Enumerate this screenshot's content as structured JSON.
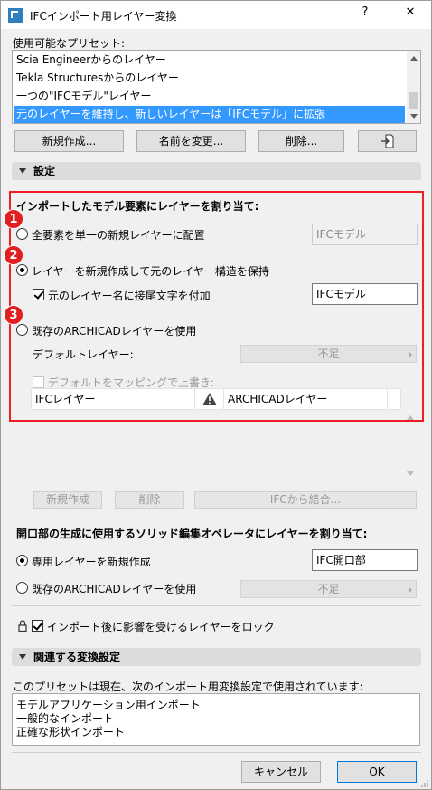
{
  "window": {
    "title": "IFCインポート用レイヤー変換",
    "help_label": "?",
    "close_label": "✕"
  },
  "presets": {
    "label": "使用可能なプリセット:",
    "items": [
      "Scia Engineerからのレイヤー",
      "Tekla Structuresからのレイヤー",
      "一つの\"IFCモデル\"レイヤー",
      "元のレイヤーを維持し、新しいレイヤーは「IFCモデル」に拡張"
    ],
    "selected_index": 3,
    "buttons": {
      "new": "新規作成...",
      "rename": "名前を変更...",
      "delete": "削除...",
      "import_icon": "import-file-icon"
    }
  },
  "settings": {
    "header": "設定",
    "assign_title": "インポートしたモデル要素にレイヤーを割り当て:",
    "option1_label": "全要素を単一の新規レイヤーに配置",
    "option1_value": "IFCモデル",
    "option2_label": "レイヤーを新規作成して元のレイヤー構造を保持",
    "option2_suffix_label": "元のレイヤー名に接尾文字を付加",
    "option2_suffix_value": "IFCモデル",
    "option3_label": "既存のARCHICADレイヤーを使用",
    "default_layer_label": "デフォルトレイヤー:",
    "default_layer_value": "不足",
    "override_label": "デフォルトをマッピングで上書き:",
    "table": {
      "col1": "IFCレイヤー",
      "col2": "ARCHICADレイヤー",
      "warning_icon": "warning-icon"
    },
    "badges": [
      "1",
      "2",
      "3"
    ],
    "table_buttons": {
      "new": "新規作成",
      "delete": "削除",
      "merge": "IFCから結合..."
    }
  },
  "openings": {
    "title": "開口部の生成に使用するソリッド編集オペレータにレイヤーを割り当て:",
    "option1_label": "専用レイヤーを新規作成",
    "option1_value": "IFC開口部",
    "option2_label": "既存のARCHICADレイヤーを使用",
    "option2_value": "不足"
  },
  "lock": {
    "label": "インポート後に影響を受けるレイヤーをロック",
    "icon": "lock-icon"
  },
  "related": {
    "header": "関連する変換設定",
    "description": "このプリセットは現在、次のインポート用変換設定で使用されています:",
    "items": [
      "モデルアプリケーション用インポート",
      "一般的なインポート",
      "正確な形状インポート"
    ]
  },
  "footer": {
    "cancel": "キャンセル",
    "ok": "OK"
  },
  "colors": {
    "selection": "#3399ff",
    "highlight_box": "#ee1c24",
    "badge": "#e02020"
  }
}
